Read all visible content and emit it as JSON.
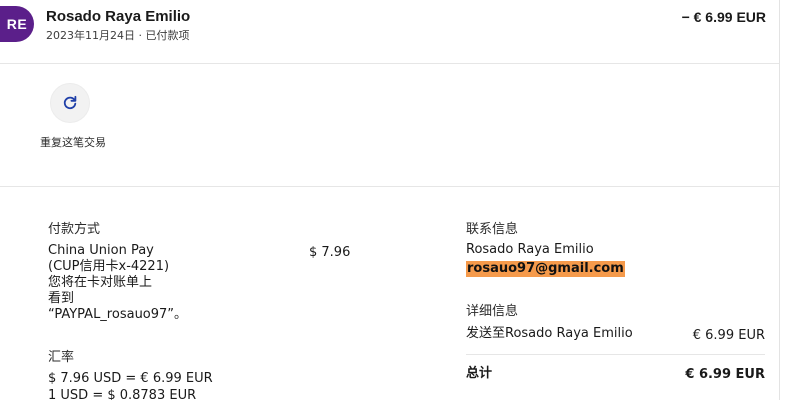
{
  "header": {
    "avatar_initials": "RE",
    "name": "Rosado Raya Emilio",
    "subtitle": "2023年11月24日 · 已付款项",
    "amount": "− € 6.99 EUR"
  },
  "actions": {
    "repeat_label": "重复这笔交易"
  },
  "payment": {
    "heading": "付款方式",
    "method_line1": "China Union Pay",
    "method_line2": "(CUP信用卡x-4221)",
    "method_line3": "您将在卡对账单上",
    "method_line4": "看到",
    "method_line5": "“PAYPAL_rosauo97”。",
    "amount": "$ 7.96"
  },
  "exchange": {
    "heading": "汇率",
    "line1": "$ 7.96 USD = € 6.99 EUR",
    "line2": "1 USD = $ 0.8783 EUR"
  },
  "contact": {
    "heading": "联系信息",
    "name": "Rosado Raya Emilio",
    "email": "rosauo97@gmail.com"
  },
  "details": {
    "heading": "详细信息",
    "sent_to": "发送至Rosado Raya Emilio",
    "sent_amount": "€ 6.99 EUR",
    "total_label": "总计",
    "total_amount": "€ 6.99 EUR"
  },
  "colors": {
    "avatar_bg": "#5b1f8a",
    "email_highlight": "#f59a4b"
  }
}
